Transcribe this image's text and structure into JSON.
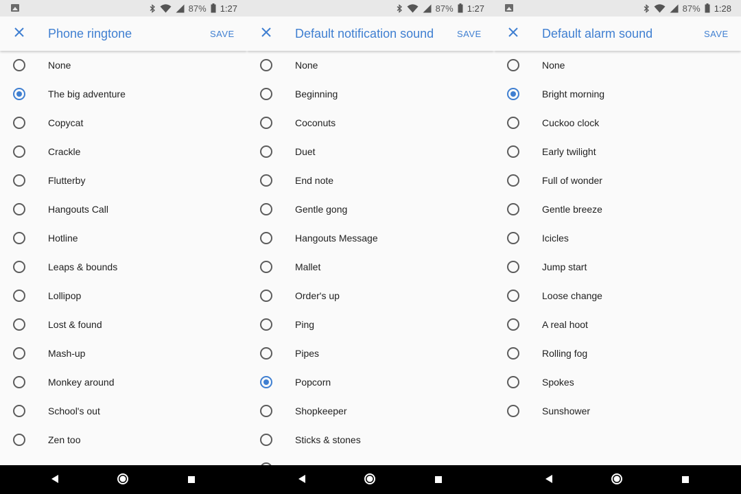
{
  "screens": [
    {
      "status": {
        "battery": "87%",
        "time": "1:27",
        "left_icon": "image-notification-icon"
      },
      "title": "Phone ringtone",
      "save_label": "SAVE",
      "items": [
        {
          "label": "None",
          "selected": false
        },
        {
          "label": "The big adventure",
          "selected": true
        },
        {
          "label": "Copycat",
          "selected": false
        },
        {
          "label": "Crackle",
          "selected": false
        },
        {
          "label": "Flutterby",
          "selected": false
        },
        {
          "label": "Hangouts Call",
          "selected": false
        },
        {
          "label": "Hotline",
          "selected": false
        },
        {
          "label": "Leaps & bounds",
          "selected": false
        },
        {
          "label": "Lollipop",
          "selected": false
        },
        {
          "label": "Lost & found",
          "selected": false
        },
        {
          "label": "Mash-up",
          "selected": false
        },
        {
          "label": "Monkey around",
          "selected": false
        },
        {
          "label": "School's out",
          "selected": false
        },
        {
          "label": "Zen too",
          "selected": false
        }
      ]
    },
    {
      "status": {
        "battery": "87%",
        "time": "1:27",
        "left_icon": ""
      },
      "title": "Default notification sound",
      "save_label": "SAVE",
      "items": [
        {
          "label": "None",
          "selected": false
        },
        {
          "label": "Beginning",
          "selected": false
        },
        {
          "label": "Coconuts",
          "selected": false
        },
        {
          "label": "Duet",
          "selected": false
        },
        {
          "label": "End note",
          "selected": false
        },
        {
          "label": "Gentle gong",
          "selected": false
        },
        {
          "label": "Hangouts Message",
          "selected": false
        },
        {
          "label": "Mallet",
          "selected": false
        },
        {
          "label": "Order's up",
          "selected": false
        },
        {
          "label": "Ping",
          "selected": false
        },
        {
          "label": "Pipes",
          "selected": false
        },
        {
          "label": "Popcorn",
          "selected": true
        },
        {
          "label": "Shopkeeper",
          "selected": false
        },
        {
          "label": "Sticks & stones",
          "selected": false
        },
        {
          "label": "",
          "selected": false
        }
      ]
    },
    {
      "status": {
        "battery": "87%",
        "time": "1:28",
        "left_icon": "image-notification-icon"
      },
      "title": "Default alarm sound",
      "save_label": "SAVE",
      "items": [
        {
          "label": "None",
          "selected": false
        },
        {
          "label": "Bright morning",
          "selected": true
        },
        {
          "label": "Cuckoo clock",
          "selected": false
        },
        {
          "label": "Early twilight",
          "selected": false
        },
        {
          "label": "Full of wonder",
          "selected": false
        },
        {
          "label": "Gentle breeze",
          "selected": false
        },
        {
          "label": "Icicles",
          "selected": false
        },
        {
          "label": "Jump start",
          "selected": false
        },
        {
          "label": "Loose change",
          "selected": false
        },
        {
          "label": "A real hoot",
          "selected": false
        },
        {
          "label": "Rolling fog",
          "selected": false
        },
        {
          "label": "Spokes",
          "selected": false
        },
        {
          "label": "Sunshower",
          "selected": false
        }
      ]
    }
  ],
  "colors": {
    "accent": "#3f7fd1",
    "text": "#212121",
    "statusbar": "#e8e8e8",
    "navbar": "#000000"
  },
  "navbar": {
    "buttons": [
      "back-icon",
      "home-icon",
      "recents-icon"
    ]
  }
}
